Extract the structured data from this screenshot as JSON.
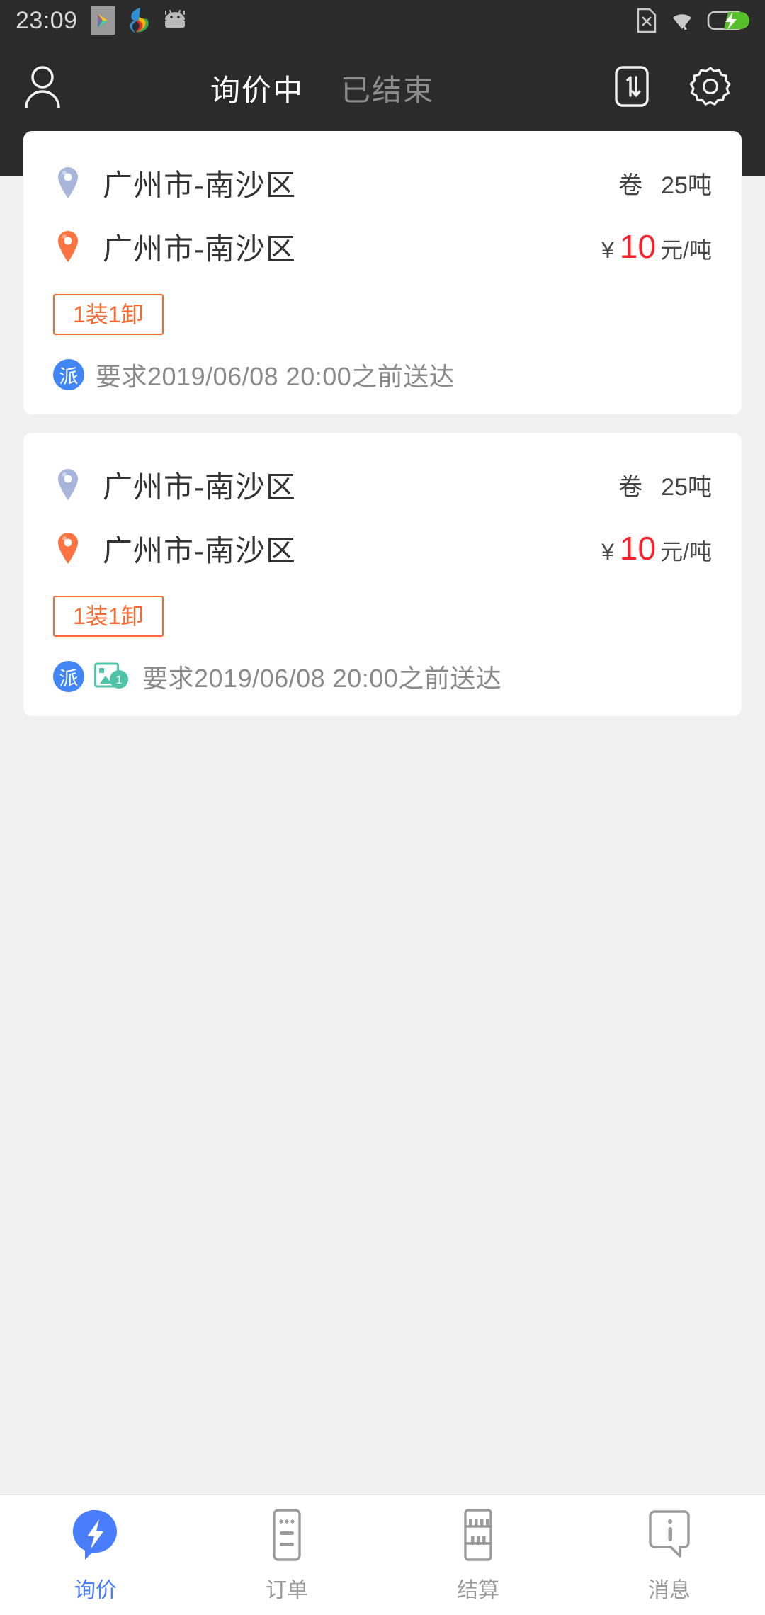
{
  "status_bar": {
    "time": "23:09",
    "left_icons": [
      "play-store-icon",
      "sync-app-icon",
      "android-robot-icon"
    ],
    "right_icons": [
      "sim-card-off-icon",
      "wifi-icon",
      "battery-charging-icon"
    ]
  },
  "header": {
    "profile_icon": "user-icon",
    "tabs": [
      {
        "label": "询价中",
        "active": true
      },
      {
        "label": "已结束",
        "active": false
      }
    ],
    "sort_icon": "sort-one-way-icon",
    "settings_icon": "gear-icon",
    "active_color": "#ffffff",
    "inactive_color": "#8d8d8d",
    "background": "#2b2b2b"
  },
  "colors": {
    "page_background": "#f0f0f0",
    "card_background": "#ffffff",
    "price_red": "#f5222d",
    "badge_orange": "#f96a32",
    "origin_pin": "#a7b6da",
    "dest_pin": "#fb7341",
    "pai_blue": "#4285f4",
    "photo_teal": "#4ec3a8",
    "nav_active": "#4a7dfc",
    "nav_inactive": "#9b9b9b"
  },
  "cards": [
    {
      "origin": {
        "icon": "map-pin-origin-icon",
        "text": "广州市-南沙区"
      },
      "cargo_type": "卷",
      "cargo_weight": "25吨",
      "destination": {
        "icon": "map-pin-destination-icon",
        "text": "广州市-南沙区"
      },
      "currency_symbol": "¥",
      "price": "10",
      "price_unit": "元/吨",
      "load_badge": "1装1卸",
      "dispatch_tag": "派",
      "has_photo_tag": false,
      "photo_tag_count": "",
      "requirement": "要求2019/06/08 20:00之前送达"
    },
    {
      "origin": {
        "icon": "map-pin-origin-icon",
        "text": "广州市-南沙区"
      },
      "cargo_type": "卷",
      "cargo_weight": "25吨",
      "destination": {
        "icon": "map-pin-destination-icon",
        "text": "广州市-南沙区"
      },
      "currency_symbol": "¥",
      "price": "10",
      "price_unit": "元/吨",
      "load_badge": "1装1卸",
      "dispatch_tag": "派",
      "has_photo_tag": true,
      "photo_tag_count": "1",
      "requirement": "要求2019/06/08 20:00之前送达"
    }
  ],
  "bottom_nav": [
    {
      "label": "询价",
      "icon": "inquiry-bolt-icon",
      "active": true
    },
    {
      "label": "订单",
      "icon": "order-document-icon",
      "active": false
    },
    {
      "label": "结算",
      "icon": "settlement-abacus-icon",
      "active": false
    },
    {
      "label": "消息",
      "icon": "message-info-icon",
      "active": false
    }
  ]
}
